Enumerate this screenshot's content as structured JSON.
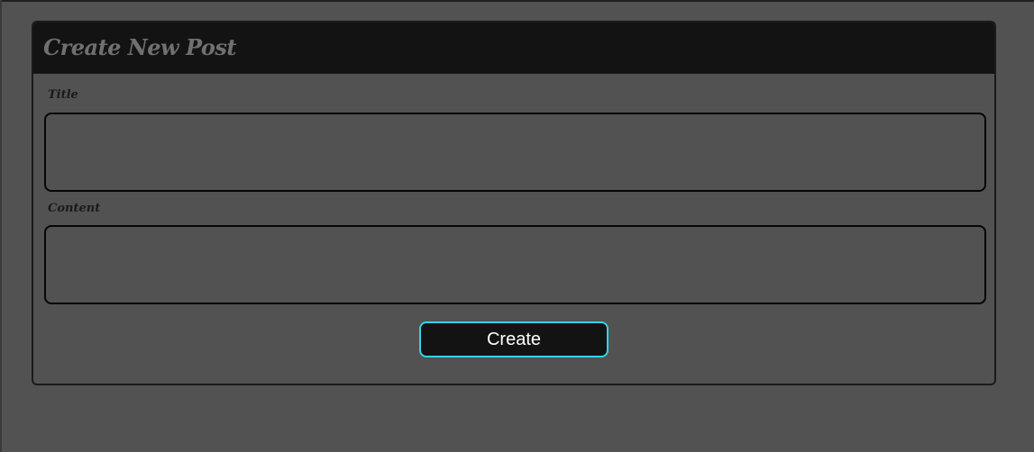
{
  "form": {
    "title": "Create New Post",
    "fields": [
      {
        "label": "Title",
        "value": "",
        "placeholder": ""
      },
      {
        "label": "Content",
        "value": "",
        "placeholder": ""
      }
    ],
    "submit_label": "Create"
  },
  "colors": {
    "page_background": "#525252",
    "header_background": "#131313",
    "title_text": "#707070",
    "label_text": "#1a1a1a",
    "input_border": "#050505",
    "button_background": "#131313",
    "button_border": "#2fd6e3",
    "button_text": "#ffffff"
  }
}
